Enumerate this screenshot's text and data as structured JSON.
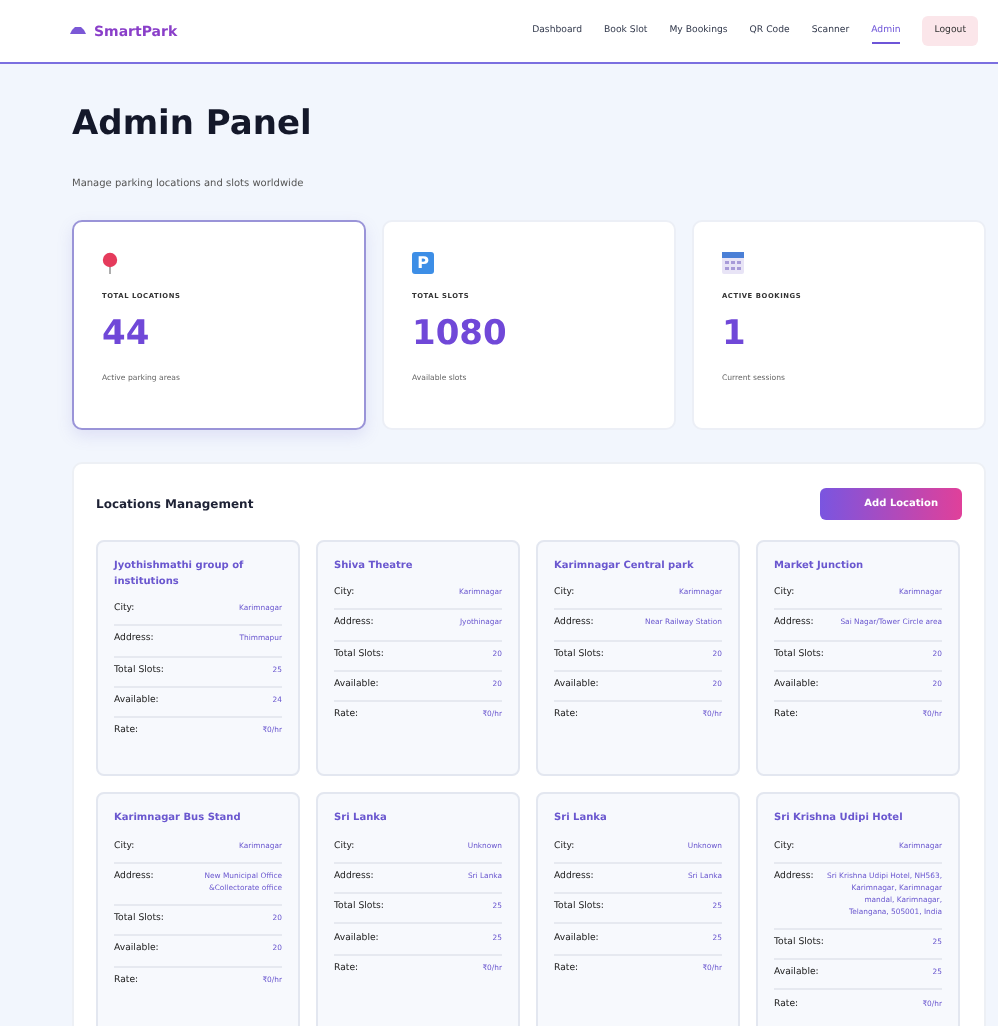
{
  "brand": "SmartPark",
  "nav": [
    {
      "label": "Dashboard",
      "selected": false
    },
    {
      "label": "Book Slot",
      "selected": false
    },
    {
      "label": "My Bookings",
      "selected": false
    },
    {
      "label": "QR Code",
      "selected": false
    },
    {
      "label": "Scanner",
      "selected": false
    },
    {
      "label": "Admin",
      "selected": true
    }
  ],
  "logout": "Logout",
  "title": "Admin Panel",
  "subtitle": "Manage parking locations and slots worldwide",
  "stats": [
    {
      "kind": "pin",
      "label": "TOTAL LOCATIONS",
      "value": "44",
      "caption": "Active parking areas",
      "highlighted": true
    },
    {
      "kind": "parking",
      "icon_text": "P",
      "label": "TOTAL SLOTS",
      "value": "1080",
      "caption": "Available slots",
      "highlighted": false
    },
    {
      "kind": "calendar",
      "label": "ACTIVE BOOKINGS",
      "value": "1",
      "caption": "Current sessions",
      "highlighted": false
    }
  ],
  "locations": {
    "title": "Locations Management",
    "add_button": "Add Location",
    "cards": [
      {
        "name": "Jyothishmathi group of institutions",
        "fields": [
          {
            "label": "City:",
            "value": "Karimnagar"
          },
          {
            "label": "Address:",
            "value": "Thimmapur"
          },
          {
            "label": "Total Slots:",
            "value": "25"
          },
          {
            "label": "Available:",
            "value": "24"
          },
          {
            "label": "Rate:",
            "value": "₹0/hr"
          }
        ]
      },
      {
        "name": "Shiva Theatre",
        "fields": [
          {
            "label": "City:",
            "value": "Karimnagar"
          },
          {
            "label": "Address:",
            "value": "Jyothinagar"
          },
          {
            "label": "Total Slots:",
            "value": "20"
          },
          {
            "label": "Available:",
            "value": "20"
          },
          {
            "label": "Rate:",
            "value": "₹0/hr"
          }
        ]
      },
      {
        "name": "Karimnagar Central park",
        "fields": [
          {
            "label": "City:",
            "value": "Karimnagar"
          },
          {
            "label": "Address:",
            "value": "Near Railway Station"
          },
          {
            "label": "Total Slots:",
            "value": "20"
          },
          {
            "label": "Available:",
            "value": "20"
          },
          {
            "label": "Rate:",
            "value": "₹0/hr"
          }
        ]
      },
      {
        "name": "Market Junction",
        "fields": [
          {
            "label": "City:",
            "value": "Karimnagar"
          },
          {
            "label": "Address:",
            "value": "Sai Nagar/Tower Circle area"
          },
          {
            "label": "Total Slots:",
            "value": "20"
          },
          {
            "label": "Available:",
            "value": "20"
          },
          {
            "label": "Rate:",
            "value": "₹0/hr"
          }
        ]
      },
      {
        "name": "Karimnagar Bus Stand",
        "fields": [
          {
            "label": "City:",
            "value": "Karimnagar"
          },
          {
            "label": "Address:",
            "value": "New Municipal Office &Collectorate office"
          },
          {
            "label": "Total Slots:",
            "value": "20"
          },
          {
            "label": "Available:",
            "value": "20"
          },
          {
            "label": "Rate:",
            "value": "₹0/hr"
          }
        ]
      },
      {
        "name": "Sri Lanka",
        "fields": [
          {
            "label": "City:",
            "value": "Unknown"
          },
          {
            "label": "Address:",
            "value": "Sri Lanka"
          },
          {
            "label": "Total Slots:",
            "value": "25"
          },
          {
            "label": "Available:",
            "value": "25"
          },
          {
            "label": "Rate:",
            "value": "₹0/hr"
          }
        ]
      },
      {
        "name": "Sri Lanka",
        "fields": [
          {
            "label": "City:",
            "value": "Unknown"
          },
          {
            "label": "Address:",
            "value": "Sri Lanka"
          },
          {
            "label": "Total Slots:",
            "value": "25"
          },
          {
            "label": "Available:",
            "value": "25"
          },
          {
            "label": "Rate:",
            "value": "₹0/hr"
          }
        ]
      },
      {
        "name": "Sri Krishna Udipi Hotel",
        "fields": [
          {
            "label": "City:",
            "value": "Karimnagar"
          },
          {
            "label": "Address:",
            "value": "Sri Krishna Udipi Hotel, NH563, Karimnagar, Karimnagar mandal, Karimnagar, Telangana, 505001, India"
          },
          {
            "label": "Total Slots:",
            "value": "25"
          },
          {
            "label": "Available:",
            "value": "25"
          },
          {
            "label": "Rate:",
            "value": "₹0/hr"
          }
        ]
      }
    ]
  }
}
